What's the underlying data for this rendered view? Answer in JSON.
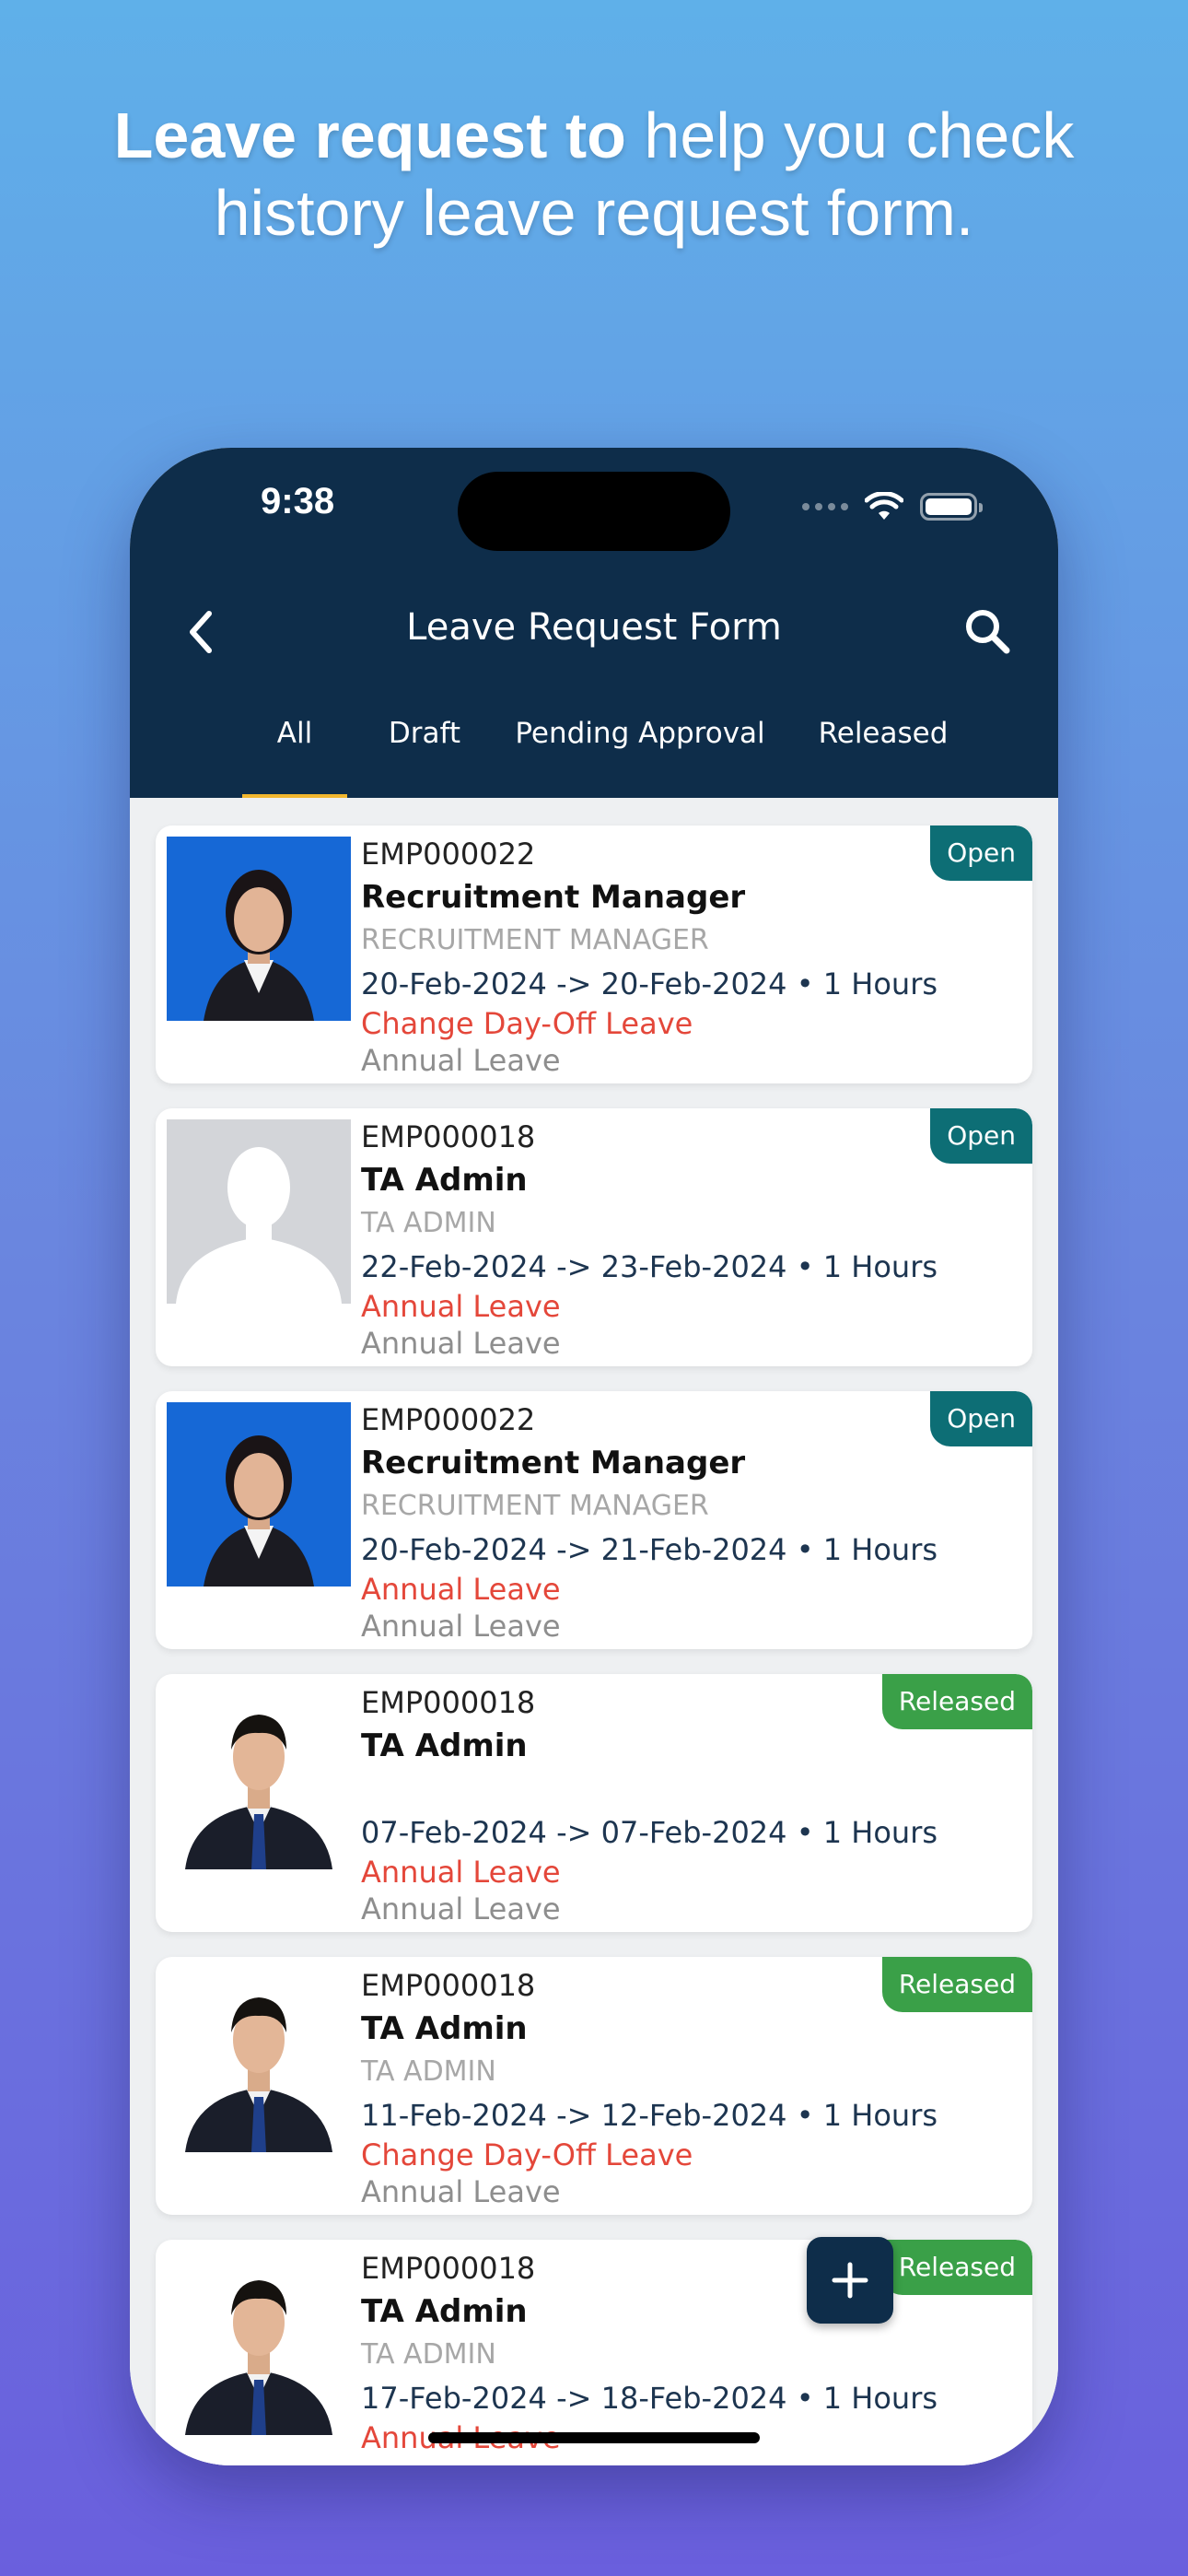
{
  "headline": {
    "bold": "Leave request to",
    "rest": " help you check history leave request form."
  },
  "status_bar": {
    "time": "9:38"
  },
  "nav": {
    "title": "Leave Request Form"
  },
  "tabs": [
    {
      "label": "All",
      "active": true
    },
    {
      "label": "Draft"
    },
    {
      "label": "Pending Approval"
    },
    {
      "label": "Released"
    }
  ],
  "requests": [
    {
      "emp_id": "EMP000022",
      "name": "Recruitment Manager",
      "position": "RECRUITMENT MANAGER",
      "dates": "20-Feb-2024 -> 20-Feb-2024  • 1 Hours",
      "leave_type": "Change Day-Off Leave",
      "leave_sub": "Annual Leave",
      "status": "Open",
      "photo": "female-blue-background"
    },
    {
      "emp_id": "EMP000018",
      "name": "TA Admin",
      "position": "TA ADMIN",
      "dates": "22-Feb-2024 -> 23-Feb-2024  • 1 Hours",
      "leave_type": "Annual Leave",
      "leave_sub": "Annual Leave",
      "status": "Open",
      "photo": "placeholder-avatar"
    },
    {
      "emp_id": "EMP000022",
      "name": "Recruitment Manager",
      "position": "RECRUITMENT MANAGER",
      "dates": "20-Feb-2024 -> 21-Feb-2024  • 1 Hours",
      "leave_type": "Annual Leave",
      "leave_sub": "Annual Leave",
      "status": "Open",
      "photo": "female-blue-background"
    },
    {
      "emp_id": "EMP000018",
      "name": "TA Admin",
      "position": "",
      "dates": "07-Feb-2024 -> 07-Feb-2024  • 1 Hours",
      "leave_type": "Annual Leave",
      "leave_sub": "Annual Leave",
      "status": "Released",
      "photo": "male-white-background"
    },
    {
      "emp_id": "EMP000018",
      "name": "TA Admin",
      "position": "TA ADMIN",
      "dates": "11-Feb-2024 -> 12-Feb-2024  • 1 Hours",
      "leave_type": "Change Day-Off Leave",
      "leave_sub": "Annual Leave",
      "status": "Released",
      "photo": "male-white-background"
    },
    {
      "emp_id": "EMP000018",
      "name": "TA Admin",
      "position": "TA ADMIN",
      "dates": "17-Feb-2024 -> 18-Feb-2024  • 1 Hours",
      "leave_type": "Annual Leave",
      "leave_sub": "",
      "status": "Released",
      "photo": "male-white-background"
    }
  ],
  "icons": {
    "back": "chevron-left-icon",
    "search": "search-icon",
    "fab": "plus-icon",
    "wifi": "wifi-icon",
    "battery": "battery-icon",
    "signal": "cellular-signal-icon"
  },
  "colors": {
    "header": "#0e2d4a",
    "tab_indicator": "#f2b72e",
    "badge_open": "#0d6e75",
    "badge_released": "#3aa048",
    "leave_type": "#e4473a"
  }
}
